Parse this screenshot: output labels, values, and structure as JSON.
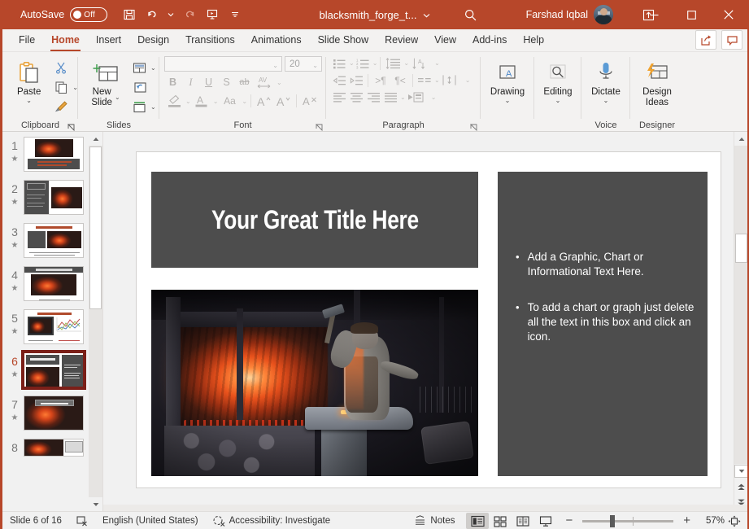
{
  "titlebar": {
    "autosave_label": "AutoSave",
    "autosave_state": "Off",
    "quick_access": [
      {
        "name": "save-button",
        "label": "Save"
      },
      {
        "name": "undo-button",
        "label": "Undo"
      },
      {
        "name": "redo-button",
        "label": "Redo"
      },
      {
        "name": "start-from-beginning-button",
        "label": "Start From Beginning"
      },
      {
        "name": "customize-quick-access-toolbar-button",
        "label": "Customize Quick Access Toolbar"
      }
    ],
    "document_title": "blacksmith_forge_t...",
    "search_label": "Search",
    "user_name": "Farshad Iqbal",
    "ribbon_display_options_label": "Ribbon Display Options",
    "minimize_label": "Minimize",
    "restore_label": "Restore Down",
    "close_label": "Close"
  },
  "tabs": [
    {
      "label": "File",
      "active": false
    },
    {
      "label": "Home",
      "active": true
    },
    {
      "label": "Insert",
      "active": false
    },
    {
      "label": "Design",
      "active": false
    },
    {
      "label": "Transitions",
      "active": false
    },
    {
      "label": "Animations",
      "active": false
    },
    {
      "label": "Slide Show",
      "active": false
    },
    {
      "label": "Review",
      "active": false
    },
    {
      "label": "View",
      "active": false
    },
    {
      "label": "Add-ins",
      "active": false
    },
    {
      "label": "Help",
      "active": false
    }
  ],
  "tab_right_buttons": [
    {
      "name": "share-button",
      "label": "Share"
    },
    {
      "name": "comments-button",
      "label": "Comments"
    }
  ],
  "ribbon": {
    "clipboard": {
      "group_label": "Clipboard",
      "paste_label": "Paste",
      "cut_label": "Cut",
      "copy_label": "Copy",
      "format_painter_label": "Format Painter",
      "dialog_launcher_label": "Clipboard dialog launcher"
    },
    "slides": {
      "group_label": "Slides",
      "new_slide_label": "New\nSlide",
      "new_slide_line1": "New",
      "new_slide_line2": "Slide",
      "layout_label": "Layout",
      "reset_label": "Reset",
      "section_label": "Section"
    },
    "font": {
      "group_label": "Font",
      "font_name_value": "",
      "font_size_value": "20",
      "bold_label": "B",
      "italic_label": "I",
      "underline_label": "U",
      "shadow_label": "S",
      "strikethrough_label": "ab",
      "character_spacing_label": "AV",
      "text_highlight_label": "Text Highlight Color",
      "font_color_label": "Font Color",
      "change_case_label": "Aa",
      "increase_font_label": "A",
      "decrease_font_label": "A",
      "clear_formatting_label": "A",
      "dialog_launcher_label": "Font dialog launcher"
    },
    "paragraph": {
      "group_label": "Paragraph",
      "bullets_label": "Bullets",
      "numbering_label": "Numbering",
      "line_spacing_label": "Line Spacing",
      "text_direction_label": "Text Direction",
      "decrease_indent_label": "Decrease List Level",
      "increase_indent_label": "Increase List Level",
      "ltr_label": "Left-to-Right",
      "rtl_label": "Right-to-Left",
      "columns_label": "Add or Remove Columns",
      "align_text_label": "Align Text",
      "align_left_label": "Align Left",
      "center_label": "Center",
      "align_right_label": "Align Right",
      "justify_label": "Justify",
      "smartart_label": "Convert to SmartArt",
      "dialog_launcher_label": "Paragraph dialog launcher"
    },
    "drawing": {
      "group_label": "",
      "button_label": "Drawing"
    },
    "editing": {
      "group_label": "",
      "button_label": "Editing"
    },
    "voice": {
      "group_label": "Voice",
      "button_label": "Dictate"
    },
    "designer": {
      "group_label": "Designer",
      "button_line1": "Design",
      "button_line2": "Ideas"
    }
  },
  "thumbnails": [
    {
      "number": "1",
      "selected": false,
      "layout": "title-image-top"
    },
    {
      "number": "2",
      "selected": false,
      "layout": "dark-left-text-right-image"
    },
    {
      "number": "3",
      "selected": false,
      "layout": "title-two-panels"
    },
    {
      "number": "4",
      "selected": false,
      "layout": "titlebar-over-image"
    },
    {
      "number": "5",
      "selected": false,
      "layout": "image-and-chart"
    },
    {
      "number": "6",
      "selected": true,
      "layout": "title-image-and-textbox"
    },
    {
      "number": "7",
      "selected": false,
      "layout": "full-image-with-title"
    },
    {
      "number": "8",
      "selected": false,
      "layout": "partial"
    }
  ],
  "slide": {
    "title": "Your Great Title Here",
    "bullets": [
      "Add a Graphic, Chart or Informational Text Here.",
      "To add a chart or graph just delete all the text in this box and click an icon."
    ],
    "image_alt": "Blacksmith striking hot metal on an anvil beside a glowing forge"
  },
  "statusbar": {
    "slide_counter": "Slide 6 of 16",
    "slide_notes_icon_label": "Slide Notes",
    "language": "English (United States)",
    "accessibility": "Accessibility: Investigate",
    "notes_label": "Notes",
    "views": [
      {
        "name": "normal-view-button",
        "label": "Normal",
        "active": true
      },
      {
        "name": "slide-sorter-view-button",
        "label": "Slide Sorter",
        "active": false
      },
      {
        "name": "reading-view-button",
        "label": "Reading View",
        "active": false
      },
      {
        "name": "slide-show-button",
        "label": "Slide Show",
        "active": false
      }
    ],
    "zoom_out_label": "−",
    "zoom_in_label": "+",
    "zoom_percent": "57%",
    "fit_slide_label": "Fit slide to current window"
  },
  "colors": {
    "accent": "#b7472a",
    "ribbon_bg": "#f3f2f1",
    "slide_placeholder": "#4d4d4d",
    "selection_outline": "#7b1f18"
  }
}
